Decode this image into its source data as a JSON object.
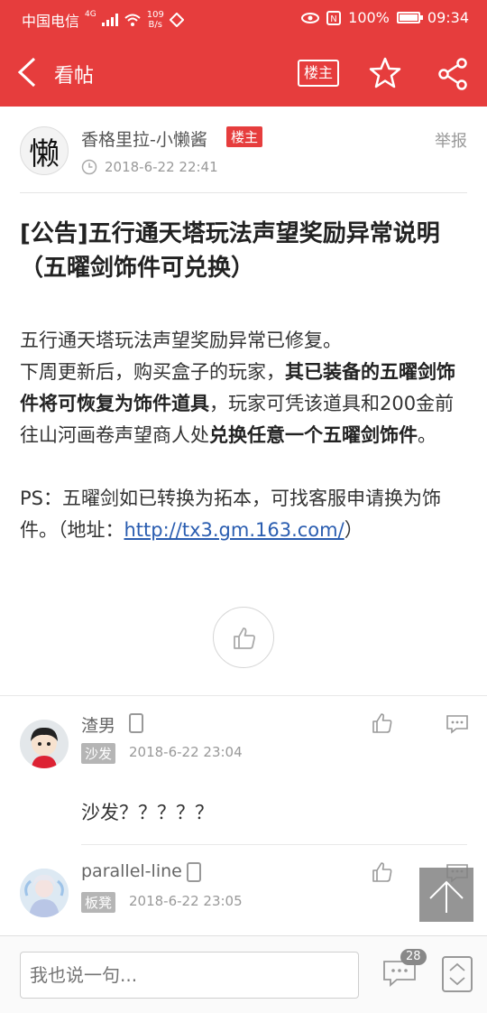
{
  "status_bar": {
    "carrier": "中国电信",
    "network_type": "4G",
    "net_speed_value": "109",
    "net_speed_unit": "B/s",
    "battery": "100%",
    "battery_level": 1.0,
    "time": "09:34"
  },
  "header": {
    "title": "看帖",
    "owner_only_label": "楼主"
  },
  "author": {
    "name": "香格里拉-小懒酱",
    "badge": "楼主",
    "avatar_char": "懒",
    "time": "2018-6-22 22:41",
    "report_label": "举报"
  },
  "post": {
    "title": "[公告]五行通天塔玩法声望奖励异常说明（五曜剑饰件可兑换）",
    "para1": "五行通天塔玩法声望奖励异常已修复。",
    "para2_a": "下周更新后，购买盒子的玩家，",
    "para2_b": "其已装备的五曜剑饰件将可恢复为饰件道具",
    "para2_c": "，玩家可凭该道具和200金前往山河画卷声望商人处",
    "para2_d": "兑换任意一个五曜剑饰件",
    "para2_e": "。",
    "ps_a": "PS：五曜剑如已转换为拓本，可找客服申请换为饰件。（地址：",
    "ps_link": "http://tx3.gm.163.com/",
    "ps_b": "）"
  },
  "comments": [
    {
      "name": "渣男",
      "tag": "沙发",
      "time": "2018-6-22 23:04",
      "text": "沙发？？？？？"
    },
    {
      "name": "parallel-line",
      "tag": "板凳",
      "time": "2018-6-22 23:05",
      "text": ""
    }
  ],
  "bottom": {
    "input_placeholder": "我也说一句...",
    "comment_count": "28"
  },
  "colors": {
    "brand_red": "#e63d3d",
    "link_blue": "#2a5db0"
  },
  "icons": [
    "back-arrow-icon",
    "star-icon",
    "share-icon",
    "clock-icon",
    "thumbs-up-icon",
    "phone-icon",
    "comment-icon",
    "arrow-up-icon",
    "scroll-updown-icon"
  ]
}
